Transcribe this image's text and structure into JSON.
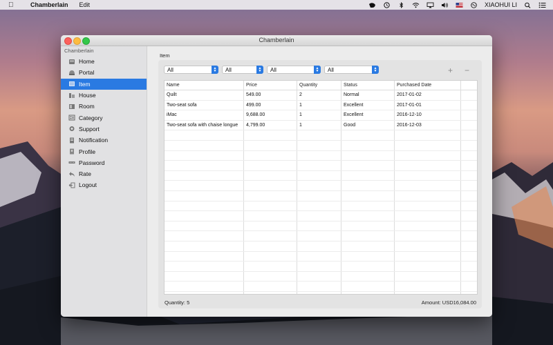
{
  "menubar": {
    "app_name": "Chamberlain",
    "menu_edit": "Edit",
    "user_name": "XIAOHUI LI",
    "icons": [
      "apple-icon",
      "evernote-icon",
      "time-machine-icon",
      "bluetooth-icon",
      "wifi-icon",
      "airplay-icon",
      "volume-icon",
      "flag-icon",
      "siri-icon",
      "user-icon",
      "spotlight-icon",
      "notification-center-icon"
    ]
  },
  "window": {
    "title": "Chamberlain"
  },
  "sidebar": {
    "header": "Chamberlain",
    "items": [
      {
        "label": "Home",
        "icon": "home-icon",
        "selected": false
      },
      {
        "label": "Portal",
        "icon": "portal-icon",
        "selected": false
      },
      {
        "label": "Item",
        "icon": "item-icon",
        "selected": true
      },
      {
        "label": "House",
        "icon": "house-icon",
        "selected": false
      },
      {
        "label": "Room",
        "icon": "room-icon",
        "selected": false
      },
      {
        "label": "Category",
        "icon": "category-icon",
        "selected": false
      },
      {
        "label": "Support",
        "icon": "support-icon",
        "selected": false
      },
      {
        "label": "Notification",
        "icon": "notification-icon",
        "selected": false
      },
      {
        "label": "Profile",
        "icon": "profile-icon",
        "selected": false
      },
      {
        "label": "Password",
        "icon": "password-icon",
        "selected": false
      },
      {
        "label": "Rate",
        "icon": "rate-icon",
        "selected": false
      },
      {
        "label": "Logout",
        "icon": "logout-icon",
        "selected": false
      }
    ]
  },
  "content": {
    "title": "Item",
    "filters": [
      "All",
      "All",
      "All",
      "All"
    ],
    "add_label": "+",
    "remove_label": "−",
    "table": {
      "headers": [
        "Name",
        "Price",
        "Quantity",
        "Status",
        "Purchased Date",
        ""
      ],
      "rows": [
        [
          "Quilt",
          "549.00",
          "2",
          "Normal",
          "2017-01-02",
          ""
        ],
        [
          "Two-seat sofa",
          "499.00",
          "1",
          "Excellent",
          "2017-01-01",
          ""
        ],
        [
          "iMac",
          "9,688.00",
          "1",
          "Excellent",
          "2016-12-10",
          ""
        ],
        [
          "Two-seat sofa with chaise longue",
          "4,799.00",
          "1",
          "Good",
          "2016-12-03",
          ""
        ]
      ]
    },
    "footer_quantity": "Quantity: 5",
    "footer_amount": "Amount: USD16,084.00"
  },
  "colors": {
    "accent": "#2a7ae2",
    "close": "#fc605c",
    "minimize": "#fdbc40",
    "maximize": "#34c84a"
  }
}
